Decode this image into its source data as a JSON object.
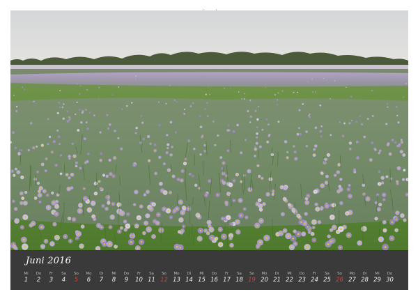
{
  "calendar": {
    "month_label": "Juni 2016",
    "days": [
      {
        "dow": "Mi",
        "num": "1"
      },
      {
        "dow": "Do",
        "num": "2"
      },
      {
        "dow": "Fr",
        "num": "3"
      },
      {
        "dow": "Sa",
        "num": "4"
      },
      {
        "dow": "So",
        "num": "5"
      },
      {
        "dow": "Mo",
        "num": "6"
      },
      {
        "dow": "Di",
        "num": "7"
      },
      {
        "dow": "Mi",
        "num": "8"
      },
      {
        "dow": "Do",
        "num": "9"
      },
      {
        "dow": "Fr",
        "num": "10"
      },
      {
        "dow": "Sa",
        "num": "11"
      },
      {
        "dow": "So",
        "num": "12"
      },
      {
        "dow": "Mo",
        "num": "13"
      },
      {
        "dow": "Di",
        "num": "14"
      },
      {
        "dow": "Mi",
        "num": "15"
      },
      {
        "dow": "Do",
        "num": "16"
      },
      {
        "dow": "Fr",
        "num": "17"
      },
      {
        "dow": "Sa",
        "num": "18"
      },
      {
        "dow": "So",
        "num": "19"
      },
      {
        "dow": "Mo",
        "num": "20"
      },
      {
        "dow": "Di",
        "num": "21"
      },
      {
        "dow": "Mi",
        "num": "22"
      },
      {
        "dow": "Do",
        "num": "23"
      },
      {
        "dow": "Fr",
        "num": "24"
      },
      {
        "dow": "Sa",
        "num": "25"
      },
      {
        "dow": "So",
        "num": "26"
      },
      {
        "dow": "Mo",
        "num": "27"
      },
      {
        "dow": "Di",
        "num": "28"
      },
      {
        "dow": "Mi",
        "num": "29"
      },
      {
        "dow": "Do",
        "num": "30"
      }
    ],
    "highlight_color": "#d2433a"
  },
  "photo": {
    "subject": "meadow-of-purple-asters",
    "sky_color": "#dcdcd8",
    "grass_color": "#5e8a3a",
    "flower_color": "#a896c8"
  }
}
